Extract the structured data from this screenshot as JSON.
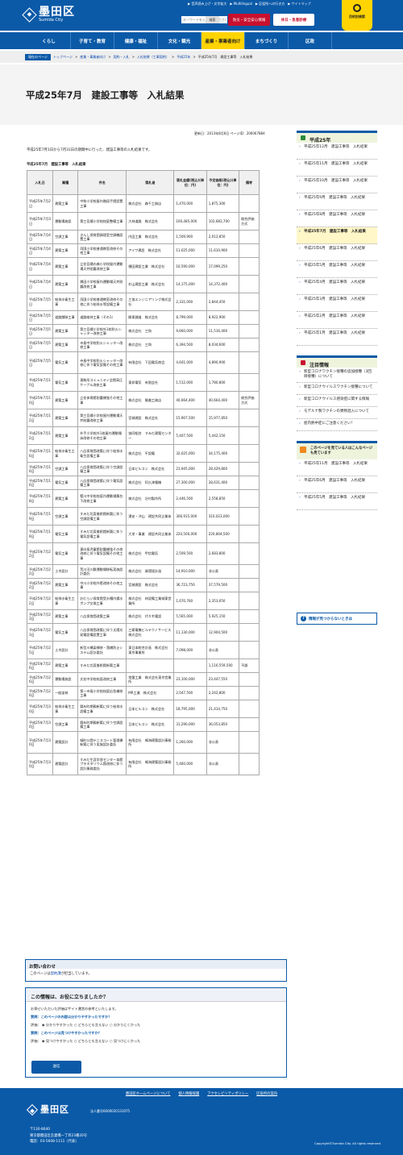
{
  "header": {
    "logo_text": "墨田区",
    "logo_sub": "Sumida City",
    "util_links": [
      "▶ 音声読み上げ・文字拡大",
      "▶ Multilingual",
      "▶ 区役所への行き方",
      "▶ サイトマップ"
    ],
    "search_placeholder": "キーワードを入力してください",
    "search_button": "検索",
    "disaster_button": "防災・安全安心情報",
    "medical_button": "休日・急患診療",
    "purpose_button": "目的別検索"
  },
  "nav": {
    "items": [
      "くらし",
      "子育て・教育",
      "健康・福祉",
      "文化・観光",
      "産業・事業者向け",
      "まちづくり",
      "区政"
    ],
    "active_index": 4
  },
  "breadcrumb": {
    "current_label": "現在のページ",
    "items": [
      "トップページ",
      "産業・事業者向け",
      "契約・入札",
      "入札結果（工事契約）",
      "平成25年"
    ],
    "current": "平成25年7月　建設工事等　入札結果"
  },
  "page": {
    "title": "平成25年7月　建設工事等　入札結果",
    "updated": "更新日：2013年8月8日 ページID：206067884",
    "intro": "平成25年7月1日から7月31日の期間中に行った、建設工事等の入札結果です。",
    "table_caption": "平成25年7月　建設工事等　入札結果"
  },
  "table": {
    "headers": [
      "入札日",
      "業種",
      "件名",
      "落札者",
      "落札金額(税込)(単位：円)",
      "予定価格(税込)(単位：円)",
      "備考"
    ],
    "rows": [
      [
        "平成25年7月2日",
        "建築工事",
        "中和小学校屋内階段手摺設置工事",
        "株式会社　森千工務店",
        "1,470,000",
        "1,875,300",
        ""
      ],
      [
        "平成25年7月3日",
        "運動場施設",
        "第三吾嬬小学校校庭整備工事",
        "大林道路　株式会社",
        "100,485,000",
        "102,683,700",
        "総合評価方式"
      ],
      [
        "平成25年7月4日",
        "空調工事",
        "きんし保育園調理室空調機設置工事",
        "内田工業　株式会社",
        "1,509,900",
        "2,012,850",
        ""
      ],
      [
        "平成25年7月4日",
        "建築工事",
        "両国小学校普通教室改修その他工事",
        "アイワ建設　株式会社",
        "11,025,000",
        "11,610,900",
        ""
      ],
      [
        "平成25年7月4日",
        "建築工事",
        "立花吾嬬の森小学校屋内運動場天井耐震改修工事",
        "樋田建設工業　株式会社",
        "16,590,000",
        "17,099,250",
        ""
      ],
      [
        "平成25年7月4日",
        "建築工事",
        "隅田小学校屋内運動場天井耐震改修工事",
        "杉山建設工業　株式会社",
        "14,175,000",
        "14,372,400",
        ""
      ],
      [
        "平成25年7月5日",
        "給排水衛生工事",
        "両国小学校普通教室改修その他に伴う給排水等設備工事",
        "三協エンジニアリング株式会社",
        "2,331,000",
        "2,844,450",
        ""
      ],
      [
        "平成25年7月5日",
        "道路舗装工事",
        "道路維持工事（その1）",
        "開東鋪道　株式会社",
        "8,799,000",
        "8,922,900",
        ""
      ],
      [
        "平成25年7月5日",
        "建築工事",
        "第三吾嬬小学校外1校防火シャッター改修工事",
        "株式会社　三和",
        "9,660,000",
        "11,516,400",
        ""
      ],
      [
        "平成25年7月5日",
        "建築工事",
        "寺島中学校防火シャッター改修工事",
        "株式会社　三和",
        "6,394,500",
        "8,034,600",
        ""
      ],
      [
        "平成25年7月5日",
        "電気工事",
        "寺島中学校防火シャッター改修に伴う電気設備その他工事",
        "有限会社　下田電気商会",
        "4,641,000",
        "4,890,900",
        ""
      ],
      [
        "平成25年7月10日",
        "電気工事",
        "東駒形コミュニティ会館高圧ケーブル改修工事",
        "東邦電気　有限会社",
        "1,512,000",
        "1,780,800",
        ""
      ],
      [
        "平成25年7月10日",
        "建築工事",
        "立花体育館耐震補強その他工事",
        "株式会社　勝美工務店",
        "40,664,400",
        "40,664,400",
        "総合評価方式"
      ],
      [
        "平成25年7月12日",
        "建築工事",
        "第三吾嬬小学校屋内運動場天井耐震改修工事",
        "宮城建設　株式会社",
        "15,907,500",
        "15,977,850",
        ""
      ],
      [
        "平成25年7月12日",
        "建築工事",
        "外手小学校外1校屋内運動場床改修その他工事",
        "協同組合　すみだ建築センター",
        "5,407,500",
        "5,442,150",
        ""
      ],
      [
        "平成25年7月16日",
        "給排水衛生工事",
        "八広保育園改築に伴う給排水衛生設備工事",
        "株式会社　平設備",
        "32,025,000",
        "34,175,400",
        ""
      ],
      [
        "平成25年7月16日",
        "空調工事",
        "八広保育園改築に伴う空調設備工事",
        "日本ビルコン　株式会社",
        "21,945,000",
        "28,429,800",
        ""
      ],
      [
        "平成25年7月16日",
        "電気工事",
        "八広保育園改築に伴う電気設備工事",
        "株式会社　阿久津電機",
        "27,300,000",
        "28,631,400",
        ""
      ],
      [
        "平成25年7月18日",
        "建築工事",
        "堅川中学校校庭内運動場舞台下改修工事",
        "株式会社　谷村製作所",
        "2,446,500",
        "2,558,850",
        ""
      ],
      [
        "平成25年7月19日",
        "空調工事",
        "すみだ北斎美術館新築に伴う空調設備工事",
        "湧安・沖山　建設共同企業体",
        "306,915,000",
        "310,023,000",
        ""
      ],
      [
        "平成25年7月19日",
        "電気工事",
        "すみだ北斎美術館新築に伴う電気設備工事",
        "大栄・事業　建設共同企業体",
        "220,500,000",
        "220,804,500",
        ""
      ],
      [
        "平成25年7月22日",
        "電気工事",
        "東向島児童館耐震補強その他改修に伴う電気設備その他工事",
        "株式会社　甲信電気",
        "2,509,500",
        "2,683,800",
        ""
      ],
      [
        "平成25年7月22日",
        "土木設計",
        "荒川河川敷運動場移転実施設計委託",
        "株式会社　資環境計画",
        "14,910,000",
        "非公表",
        ""
      ],
      [
        "平成25年7月22日",
        "建築工事",
        "中川小学校外壁改修その他工事",
        "宮城建設　株式会社",
        "36,723,750",
        "37,579,500",
        ""
      ],
      [
        "平成25年7月22日",
        "給排水衛生工事",
        "おむらい保育園受水槽内揚水ポンプ交換工事",
        "株式会社　林設備工業城東営業所",
        "1,670,760",
        "2,353,050",
        ""
      ],
      [
        "平成25年7月23日",
        "建築工事",
        "八広保育園改築工事",
        "株式会社　代々木電設",
        "5,565,000",
        "5,925,150",
        ""
      ],
      [
        "平成25年7月23日",
        "電気工事",
        "八広保育園改築に伴う太陽光発電設備設置工事",
        "三菱電機ビルテクノサービス　株式会社",
        "11,130,000",
        "12,904,500",
        ""
      ],
      [
        "平成25年7月25日",
        "土木設計",
        "新型川橋梁補修・落橋防止システム設計委託",
        "東日本総合計画　株式会社　東京事業所",
        "7,098,000",
        "非公表",
        ""
      ],
      [
        "平成25年7月26日",
        "建築工事",
        "すみだ北斎美術館新築工事",
        "",
        "",
        "1,116,559,500",
        "不調"
      ],
      [
        "平成25年7月26日",
        "運動場施設",
        "文花中学校校庭改修工事",
        "常盤工業　株式会社東京営業所",
        "23,100,000",
        "23,447,550",
        ""
      ],
      [
        "平成25年7月26日",
        "一般塗装",
        "第一寺島小学校校庭応急補修工事",
        "MR工業　株式会社",
        "2,047,500",
        "2,242,800",
        ""
      ],
      [
        "平成25年7月30日",
        "給排水衛生工事",
        "錦糸町期親新築に伴う給排水設備工事",
        "日本ビルコン　株式会社",
        "18,795,000",
        "21,414,750",
        ""
      ],
      [
        "平成25年7月30日",
        "空調工事",
        "錦糸町期親新築に伴う空調設備工事",
        "日本ビルコン　株式会社",
        "31,290,000",
        "36,053,850",
        ""
      ],
      [
        "平成25年7月30日",
        "建築設計",
        "緑町公園テニスコート管理棟新築に伴う実施設計委託",
        "有限会社　鳴海建築設計事務所",
        "1,260,000",
        "非公表",
        ""
      ],
      [
        "平成25年7月30日",
        "建築設計",
        "すみだ生涯学習センター本館プラネタリウム館改修に伴う設計業務委託",
        "有限会社　鳴海建築設計事務所",
        "5,460,000",
        "非公表",
        ""
      ]
    ]
  },
  "contact": {
    "title": "お問い合わせ",
    "text_pre": "このページは",
    "link": "契約課",
    "text_post": "が担当しています。"
  },
  "survey": {
    "title": "この情報は、お役に立ちましたか？",
    "lead": "お寄せいただいた評価はサイト運営の参考といたします。",
    "q1": "質問：このページの内容は分かりやすかったですか？",
    "q1_label": "評価：",
    "q1_opts": [
      "分かりやすかった",
      "どちらとも言えない",
      "分かりにくかった"
    ],
    "q2": "質問：このページは見つけやすかったですか？",
    "q2_label": "評価：",
    "q2_opts": [
      "見つけやすかった",
      "どちらとも言えない",
      "見つけにくかった"
    ],
    "send": "送信"
  },
  "sidebar": {
    "title": "平成25年",
    "items": [
      "平成25年12月　建設工事等　入札結果",
      "平成25年11月　建設工事等　入札結果",
      "平成25年10月　建設工事等　入札結果",
      "平成25年9月　建設工事等　入札結果",
      "平成25年8月　建設工事等　入札結果",
      "平成25年7月　建設工事等　入札結果",
      "平成25年6月　建設工事等　入札結果",
      "平成25年5月　建設工事等　入札結果",
      "平成25年4月　建設工事等　入札結果",
      "平成25年3月　建設工事等　入札結果",
      "平成25年2月　建設工事等　入札結果",
      "平成25年1月　建設工事等　入札結果"
    ],
    "current_index": 5,
    "notice_title": "注目情報",
    "notices": [
      "新型コロナワクチン接種の追加接種（3回目接種）について",
      "新型コロナウイルスワクチン接種について",
      "新型コロナウイルス感染症に関する情報",
      "モデルナ製ワクチンの異物混入について",
      "屋内熱中症にご注意ください！"
    ],
    "also_title": "このページを見ている人はこんなページも見ています",
    "also_items": [
      "平成25年11月　建設工事等　入札結果",
      "平成25年6月　建設工事等　入札結果",
      "平成25年5月　建設工事等　入札結果"
    ],
    "notfound": "情報が見つからないときは"
  },
  "footer": {
    "links": [
      "墨田区ホームページについて",
      "個人情報保護",
      "アクセシビリティポリシー",
      "区役所の案内"
    ],
    "logo_text": "墨田区",
    "code": "法人番号6000020131075",
    "zip": "〒130-8640",
    "address": "東京都墨田区吾妻橋一丁目23番20号",
    "tel": "電話：03-5608-1111（代表）",
    "copyright": "Copyright©Sumida City. All rights reserved."
  },
  "colors": {
    "brand": "#0b5aa8",
    "accent": "#ffd400",
    "alert": "#c8102e"
  }
}
